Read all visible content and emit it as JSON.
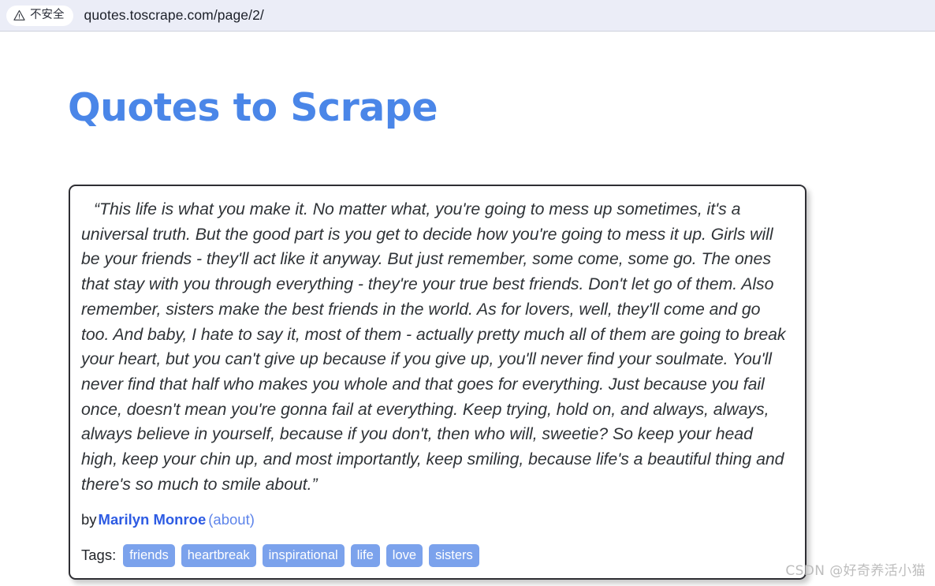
{
  "browser": {
    "security_chip": {
      "icon": "warning-triangle-icon",
      "label": "不安全"
    },
    "url": "quotes.toscrape.com/page/2/"
  },
  "page": {
    "heading": "Quotes to Scrape",
    "quote": {
      "text": "“This life is what you make it. No matter what, you're going to mess up sometimes, it's a universal truth. But the good part is you get to decide how you're going to mess it up. Girls will be your friends - they'll act like it anyway. But just remember, some come, some go. The ones that stay with you through everything - they're your true best friends. Don't let go of them. Also remember, sisters make the best friends in the world. As for lovers, well, they'll come and go too. And baby, I hate to say it, most of them - actually pretty much all of them are going to break your heart, but you can't give up because if you give up, you'll never find your soulmate. You'll never find that half who makes you whole and that goes for everything. Just because you fail once, doesn't mean you're gonna fail at everything. Keep trying, hold on, and always, always, always believe in yourself, because if you don't, then who will, sweetie? So keep your head high, keep your chin up, and most importantly, keep smiling, because life's a beautiful thing and there's so much to smile about.”",
      "by_label": "by",
      "author": "Marilyn Monroe",
      "about_label": "(about)",
      "tags_label": "Tags:",
      "tags": [
        "friends",
        "heartbreak",
        "inspirational",
        "life",
        "love",
        "sisters"
      ]
    }
  },
  "watermark": "CSDN @好奇养活小猫",
  "colors": {
    "heading_blue": "#4a86e8",
    "author_blue": "#2d5be3",
    "link_blue": "#5d84ea",
    "tag_blue": "#7ba2ec",
    "toolbar_bg": "#ebedf7",
    "card_border": "#2e2e33"
  }
}
